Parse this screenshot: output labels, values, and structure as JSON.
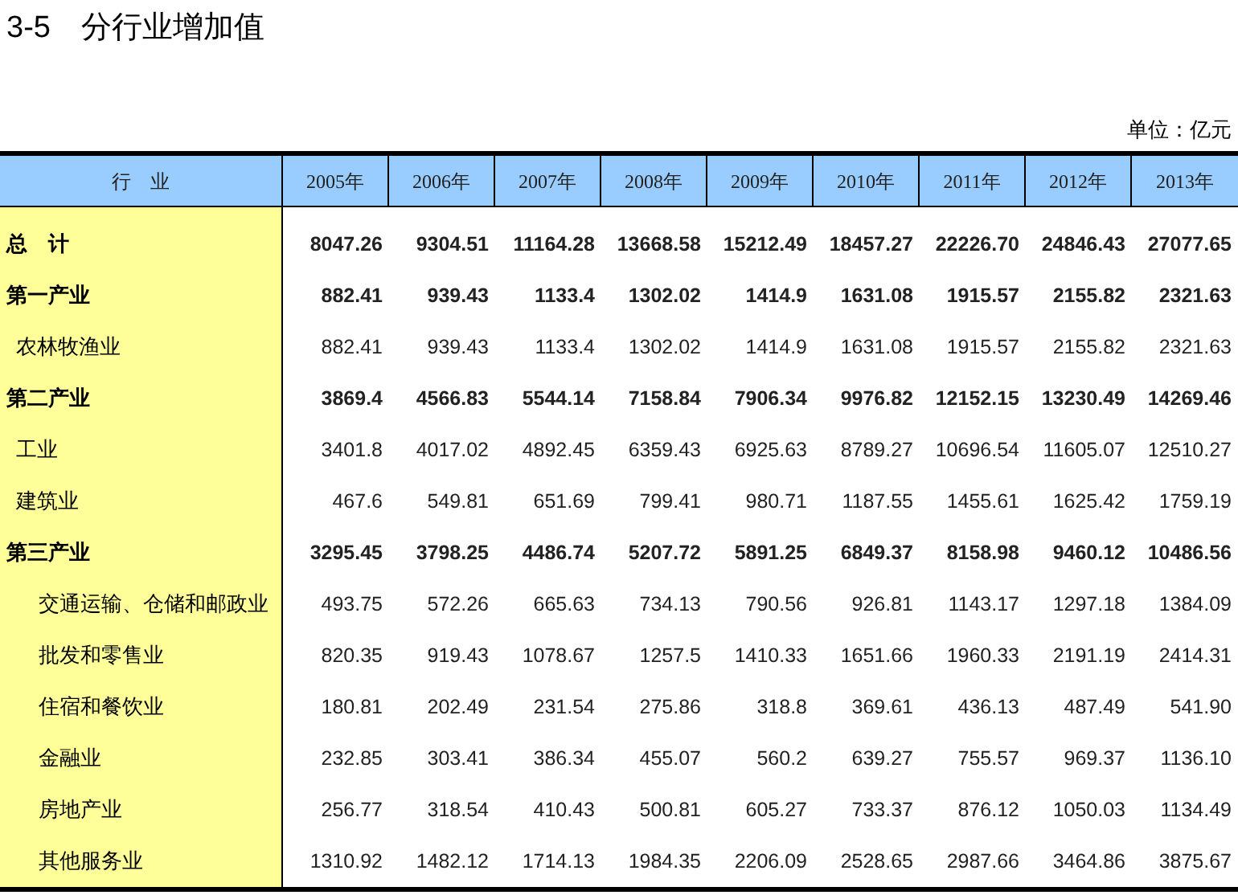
{
  "title": "3-5　分行业增加值",
  "unit": "单位：亿元",
  "table": {
    "columns": [
      "行　业",
      "2005年",
      "2006年",
      "2007年",
      "2008年",
      "2009年",
      "2010年",
      "2011年",
      "2012年",
      "2013年"
    ],
    "rows": [
      {
        "label": "总　计",
        "values": [
          "8047.26",
          "9304.51",
          "11164.28",
          "13668.58",
          "15212.49",
          "18457.27",
          "22226.70",
          "24846.43",
          "27077.65"
        ]
      },
      {
        "label": "第一产业",
        "values": [
          "882.41",
          "939.43",
          "1133.4",
          "1302.02",
          "1414.9",
          "1631.08",
          "1915.57",
          "2155.82",
          "2321.63"
        ],
        "children": [
          {
            "label": "农林牧渔业",
            "kind": "item",
            "values": [
              "882.41",
              "939.43",
              "1133.4",
              "1302.02",
              "1414.9",
              "1631.08",
              "1915.57",
              "2155.82",
              "2321.63"
            ]
          }
        ]
      },
      {
        "label": "第二产业",
        "values": [
          "3869.4",
          "4566.83",
          "5544.14",
          "7158.84",
          "7906.34",
          "9976.82",
          "12152.15",
          "13230.49",
          "14269.46"
        ],
        "children": [
          {
            "label": "工业",
            "kind": "item",
            "values": [
              "3401.8",
              "4017.02",
              "4892.45",
              "6359.43",
              "6925.63",
              "8789.27",
              "10696.54",
              "11605.07",
              "12510.27"
            ]
          },
          {
            "label": "建筑业",
            "kind": "item",
            "values": [
              "467.6",
              "549.81",
              "651.69",
              "799.41",
              "980.71",
              "1187.55",
              "1455.61",
              "1625.42",
              "1759.19"
            ]
          }
        ]
      },
      {
        "label": "第三产业",
        "values": [
          "3295.45",
          "3798.25",
          "4486.74",
          "5207.72",
          "5891.25",
          "6849.37",
          "8158.98",
          "9460.12",
          "10486.56"
        ],
        "children": [
          {
            "label": "交通运输、仓储和邮政业",
            "kind": "subitem",
            "values": [
              "493.75",
              "572.26",
              "665.63",
              "734.13",
              "790.56",
              "926.81",
              "1143.17",
              "1297.18",
              "1384.09"
            ]
          },
          {
            "label": "批发和零售业",
            "kind": "subitem",
            "values": [
              "820.35",
              "919.43",
              "1078.67",
              "1257.5",
              "1410.33",
              "1651.66",
              "1960.33",
              "2191.19",
              "2414.31"
            ]
          },
          {
            "label": "住宿和餐饮业",
            "kind": "subitem",
            "values": [
              "180.81",
              "202.49",
              "231.54",
              "275.86",
              "318.8",
              "369.61",
              "436.13",
              "487.49",
              "541.90"
            ]
          },
          {
            "label": "金融业",
            "kind": "subitem",
            "values": [
              "232.85",
              "303.41",
              "386.34",
              "455.07",
              "560.2",
              "639.27",
              "755.57",
              "969.37",
              "1136.10"
            ]
          },
          {
            "label": "房地产业",
            "kind": "subitem",
            "values": [
              "256.77",
              "318.54",
              "410.43",
              "500.81",
              "605.27",
              "733.37",
              "876.12",
              "1050.03",
              "1134.49"
            ]
          },
          {
            "label": "其他服务业",
            "kind": "subitem",
            "values": [
              "1310.92",
              "1482.12",
              "1714.13",
              "1984.35",
              "2206.09",
              "2528.65",
              "2987.66",
              "3464.86",
              "3875.67"
            ]
          }
        ]
      }
    ]
  }
}
